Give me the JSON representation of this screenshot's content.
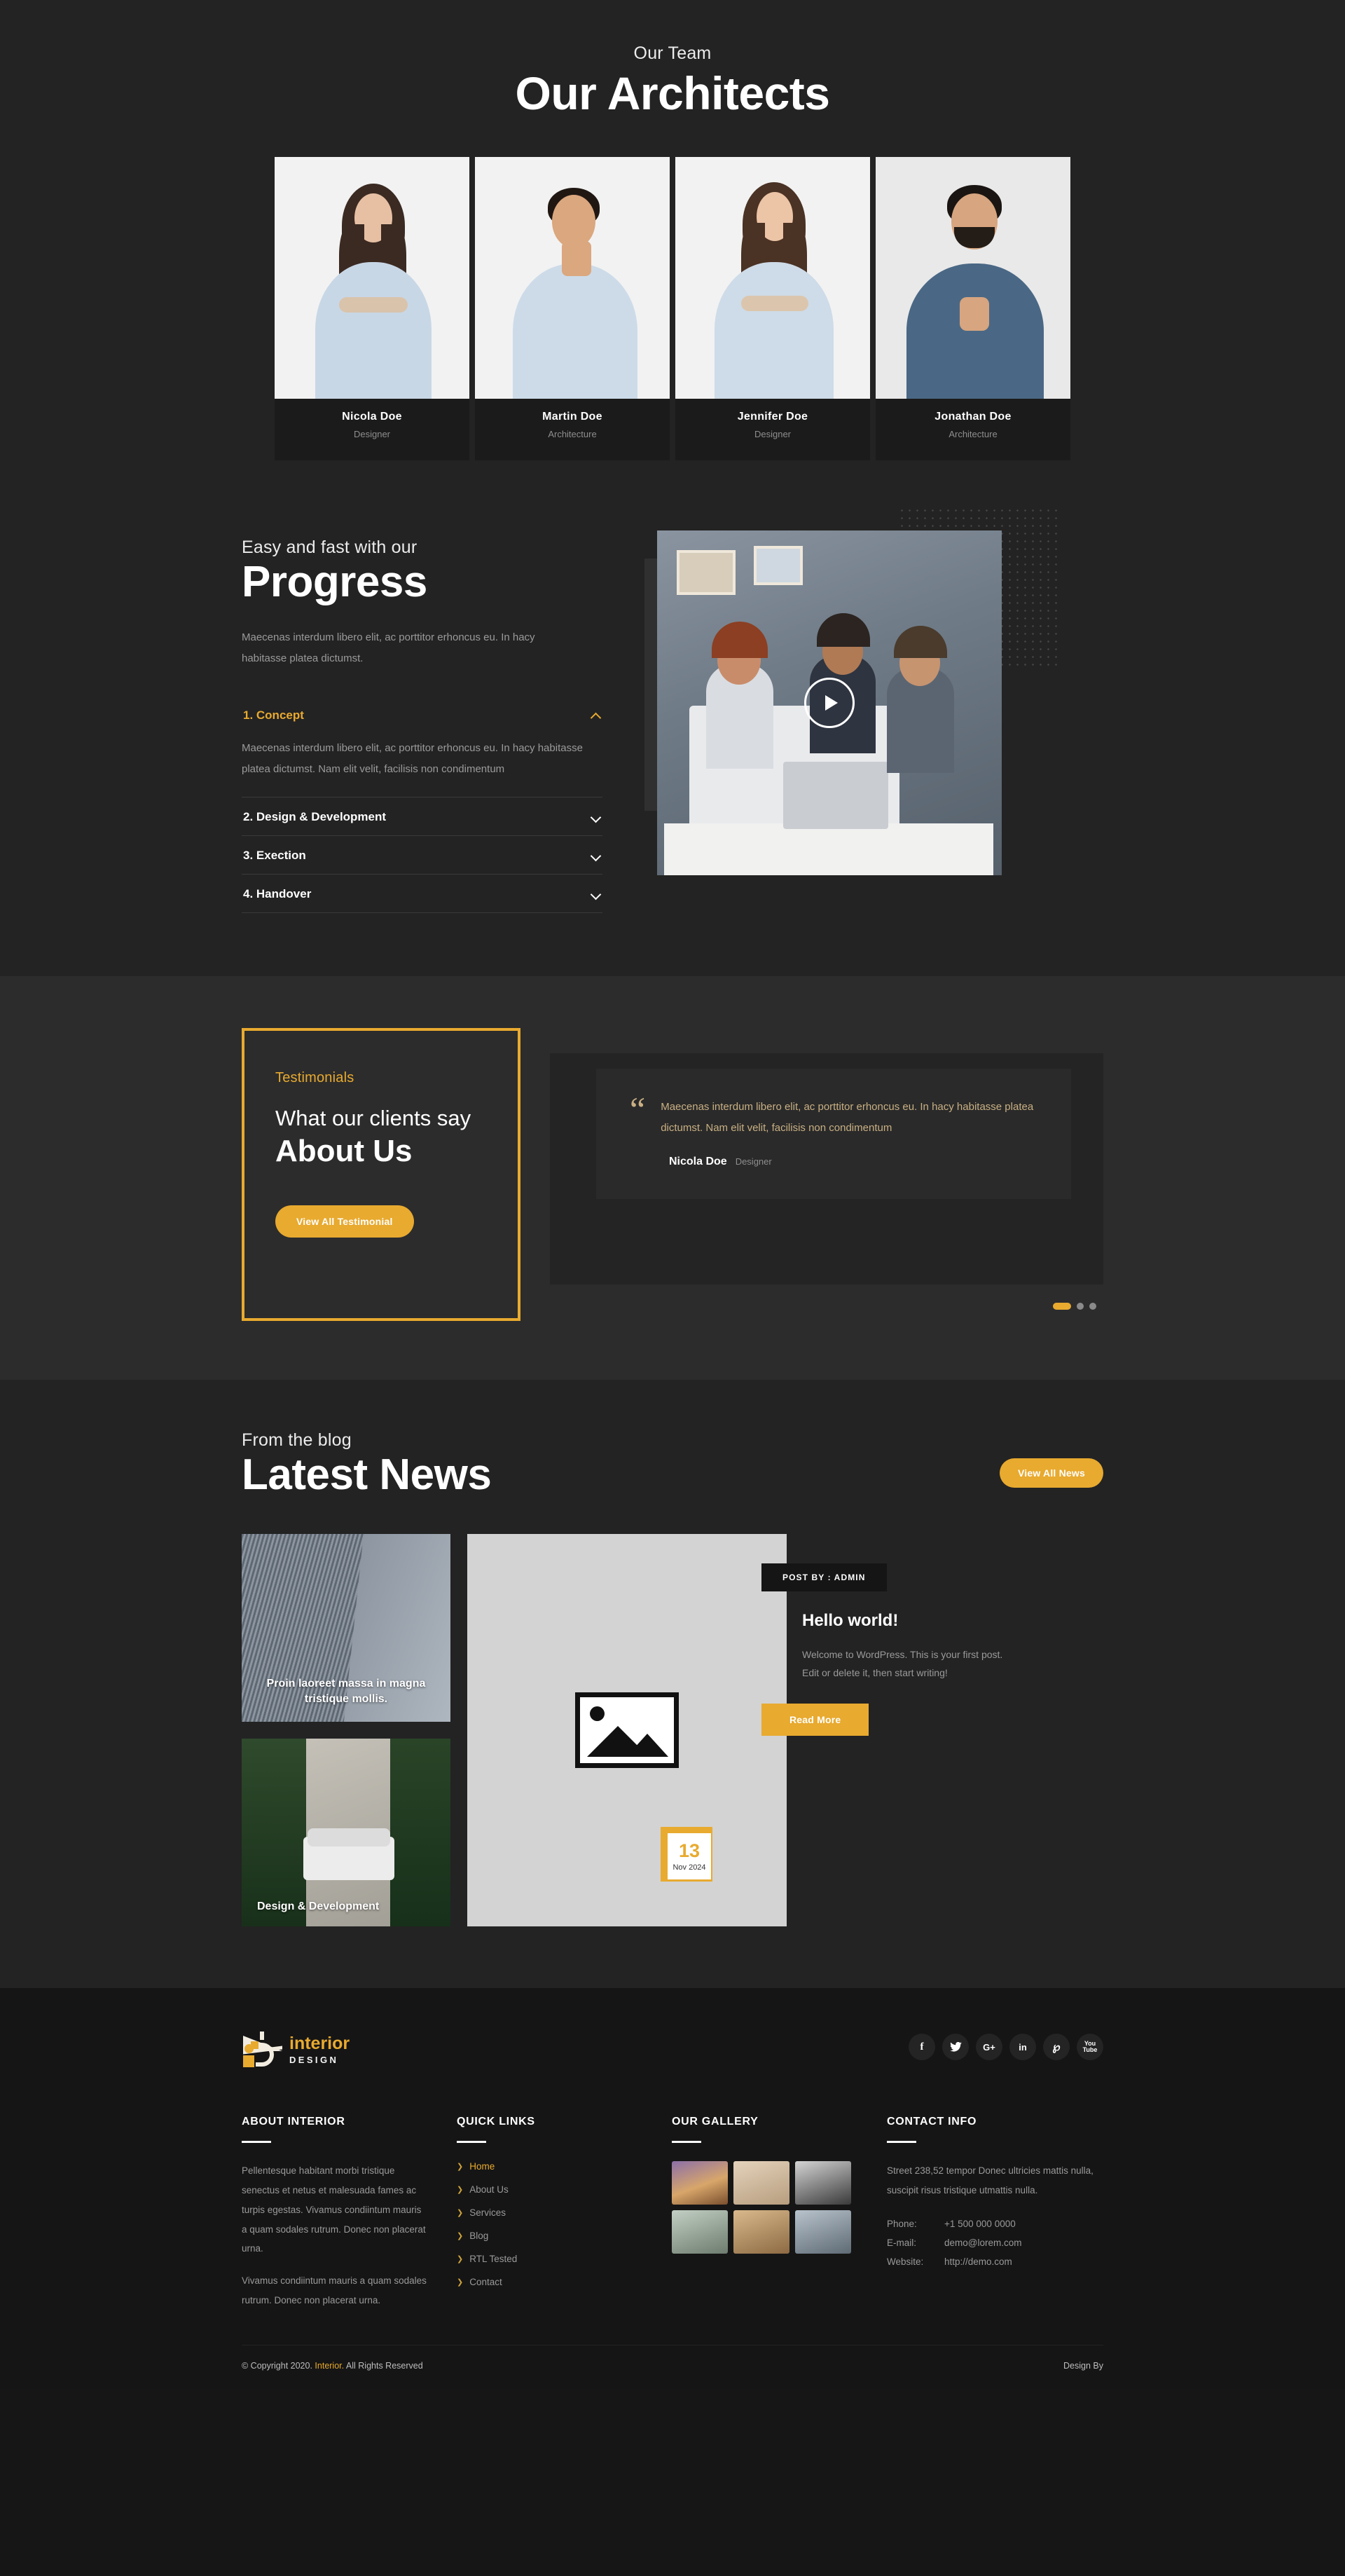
{
  "team": {
    "eyebrow": "Our Team",
    "title": "Our Architects",
    "members": [
      {
        "name": "Nicola Doe",
        "role": "Designer"
      },
      {
        "name": "Martin Doe",
        "role": "Architecture"
      },
      {
        "name": "Jennifer Doe",
        "role": "Designer"
      },
      {
        "name": "Jonathan Doe",
        "role": "Architecture"
      }
    ]
  },
  "progress": {
    "eyebrow": "Easy and fast with our",
    "title": "Progress",
    "desc": "Maecenas interdum libero elit, ac porttitor erhoncus eu. In hacy habitasse platea dictumst.",
    "accordion": [
      {
        "label": "1. Concept",
        "body": "Maecenas interdum libero elit, ac porttitor erhoncus eu. In hacy habitasse platea dictumst. Nam elit velit, facilisis non condimentum",
        "open": true
      },
      {
        "label": "2. Design & Development",
        "body": "",
        "open": false
      },
      {
        "label": "3. Exection",
        "body": "",
        "open": false
      },
      {
        "label": "4. Handover",
        "body": "",
        "open": false
      }
    ],
    "play_icon": "play-icon"
  },
  "testimonials": {
    "eyebrow": "Testimonials",
    "line1": "What our clients say",
    "line2": "About Us",
    "button": "View All Testimonial",
    "quote": "Maecenas interdum libero elit, ac porttitor erhoncus eu. In hacy habitasse platea dictumst. Nam elit velit, facilisis non condimentum",
    "author": "Nicola Doe",
    "author_role": "Designer",
    "quote_icon": "quote-icon",
    "dots": 3,
    "active_dot": 0
  },
  "blog": {
    "eyebrow": "From the blog",
    "title": "Latest News",
    "view_all": "View All News",
    "cards": [
      {
        "title": "Proin laoreet massa in magna tristique mollis."
      },
      {
        "title": "Design & Development"
      }
    ],
    "featured": {
      "post_by": "POST BY : ADMIN",
      "title": "Hello world!",
      "excerpt": "Welcome to WordPress. This is your first post. Edit or delete it, then start writing!",
      "read_more": "Read More",
      "date_day": "13",
      "date_month": "Nov 2024"
    },
    "placeholder_icon": "image-placeholder-icon"
  },
  "footer": {
    "logo": {
      "word1": "interior",
      "word2": "DESIGN"
    },
    "socials": [
      {
        "name": "facebook-icon",
        "glyph": "f"
      },
      {
        "name": "twitter-icon",
        "glyph": "ᵗ"
      },
      {
        "name": "google-plus-icon",
        "glyph": "G+"
      },
      {
        "name": "linkedin-icon",
        "glyph": "in"
      },
      {
        "name": "pinterest-icon",
        "glyph": "р"
      },
      {
        "name": "youtube-icon",
        "glyph": "▶"
      }
    ],
    "about": {
      "heading": "ABOUT INTERIOR",
      "p1": "Pellentesque habitant morbi tristique senectus et netus et malesuada fames ac turpis egestas. Vivamus condiintum mauris a quam sodales rutrum. Donec non placerat urna.",
      "p2": "Vivamus condiintum mauris a quam sodales rutrum. Donec non placerat urna."
    },
    "quick_links": {
      "heading": "QUICK LINKS",
      "items": [
        {
          "label": "Home",
          "active": true
        },
        {
          "label": "About Us",
          "active": false
        },
        {
          "label": "Services",
          "active": false
        },
        {
          "label": "Blog",
          "active": false
        },
        {
          "label": "RTL Tested",
          "active": false
        },
        {
          "label": "Contact",
          "active": false
        }
      ]
    },
    "gallery": {
      "heading": "OUR GALLERY",
      "count": 6
    },
    "contact": {
      "heading": "CONTACT INFO",
      "address": "Street 238,52 tempor Donec ultricies mattis nulla, suscipit risus tristique utmattis nulla.",
      "rows": [
        {
          "label": "Phone:",
          "value": "+1 500 000 0000"
        },
        {
          "label": "E-mail:",
          "value": "demo@lorem.com"
        },
        {
          "label": "Website:",
          "value": "http://demo.com"
        }
      ]
    },
    "copyright_pre": "© Copyright 2020.",
    "copyright_link": "Interior.",
    "copyright_post": "All Rights Reserved",
    "design_by": "Design By"
  },
  "colors": {
    "accent": "#e8aa2f",
    "bg_dark": "#232323",
    "bg_darker": "#151515",
    "panel": "#2c2c2c"
  }
}
